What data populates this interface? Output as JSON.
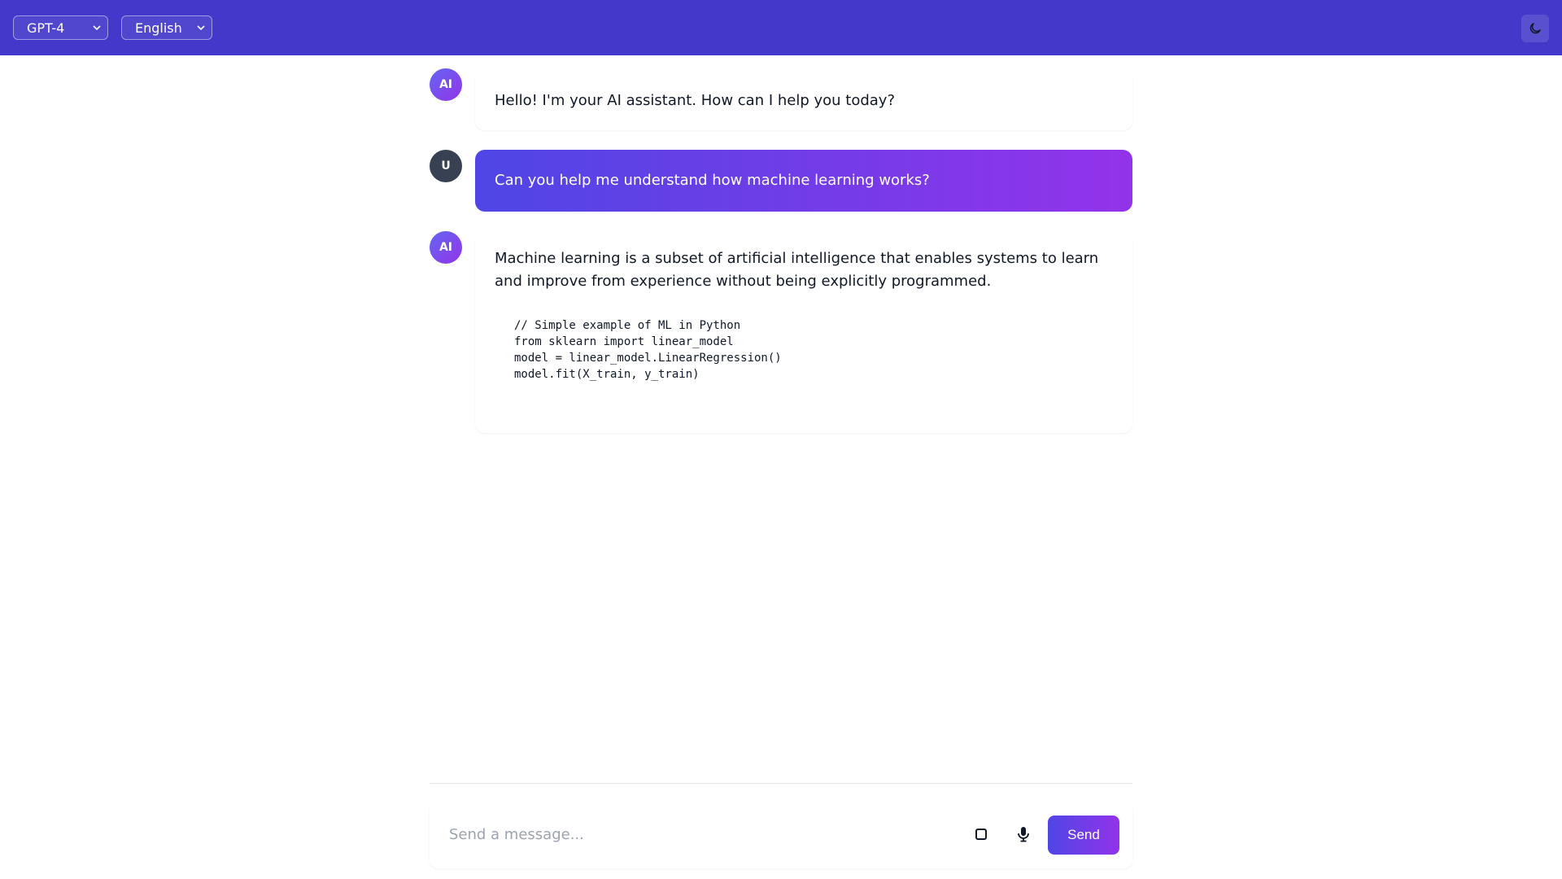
{
  "header": {
    "model_select": {
      "value": "GPT-4"
    },
    "language_select": {
      "value": "English"
    },
    "theme_toggle_icon": "moon-icon"
  },
  "messages": [
    {
      "role": "ai",
      "avatar": "AI",
      "text": "Hello! I'm your AI assistant. How can I help you today?"
    },
    {
      "role": "user",
      "avatar": "U",
      "text": "Can you help me understand how machine learning works?"
    },
    {
      "role": "ai",
      "avatar": "AI",
      "text": "Machine learning is a subset of artificial intelligence that enables systems to learn and improve from experience without being explicitly programmed.",
      "code": "// Simple example of ML in Python\nfrom sklearn import linear_model\nmodel = linear_model.LinearRegression()\nmodel.fit(X_train, y_train)"
    }
  ],
  "composer": {
    "placeholder": "Send a message...",
    "send_label": "Send",
    "stop_icon": "stop-icon",
    "mic_icon": "microphone-icon"
  },
  "colors": {
    "header": "#4338ca",
    "accent_start": "#4f46e5",
    "accent_end": "#9333ea",
    "user_avatar": "#374151"
  }
}
